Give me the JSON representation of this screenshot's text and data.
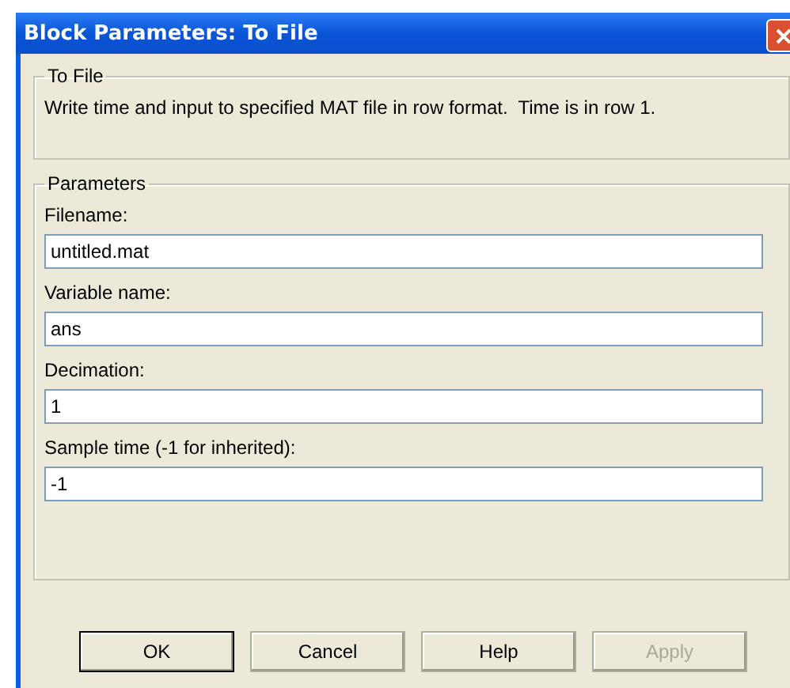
{
  "window": {
    "title": "Block Parameters: To File"
  },
  "description_group": {
    "title": "To File",
    "text": "Write time and input to specified MAT file in row format.  Time is in row 1."
  },
  "parameters_group": {
    "title": "Parameters",
    "fields": [
      {
        "label": "Filename:",
        "value": "untitled.mat"
      },
      {
        "label": "Variable name:",
        "value": "ans"
      },
      {
        "label": "Decimation:",
        "value": "1"
      },
      {
        "label": "Sample time (-1 for inherited):",
        "value": "-1"
      }
    ]
  },
  "buttons": [
    {
      "label": "OK",
      "default": true,
      "disabled": false
    },
    {
      "label": "Cancel",
      "default": false,
      "disabled": false
    },
    {
      "label": "Help",
      "default": false,
      "disabled": false
    },
    {
      "label": "Apply",
      "default": false,
      "disabled": true
    }
  ]
}
